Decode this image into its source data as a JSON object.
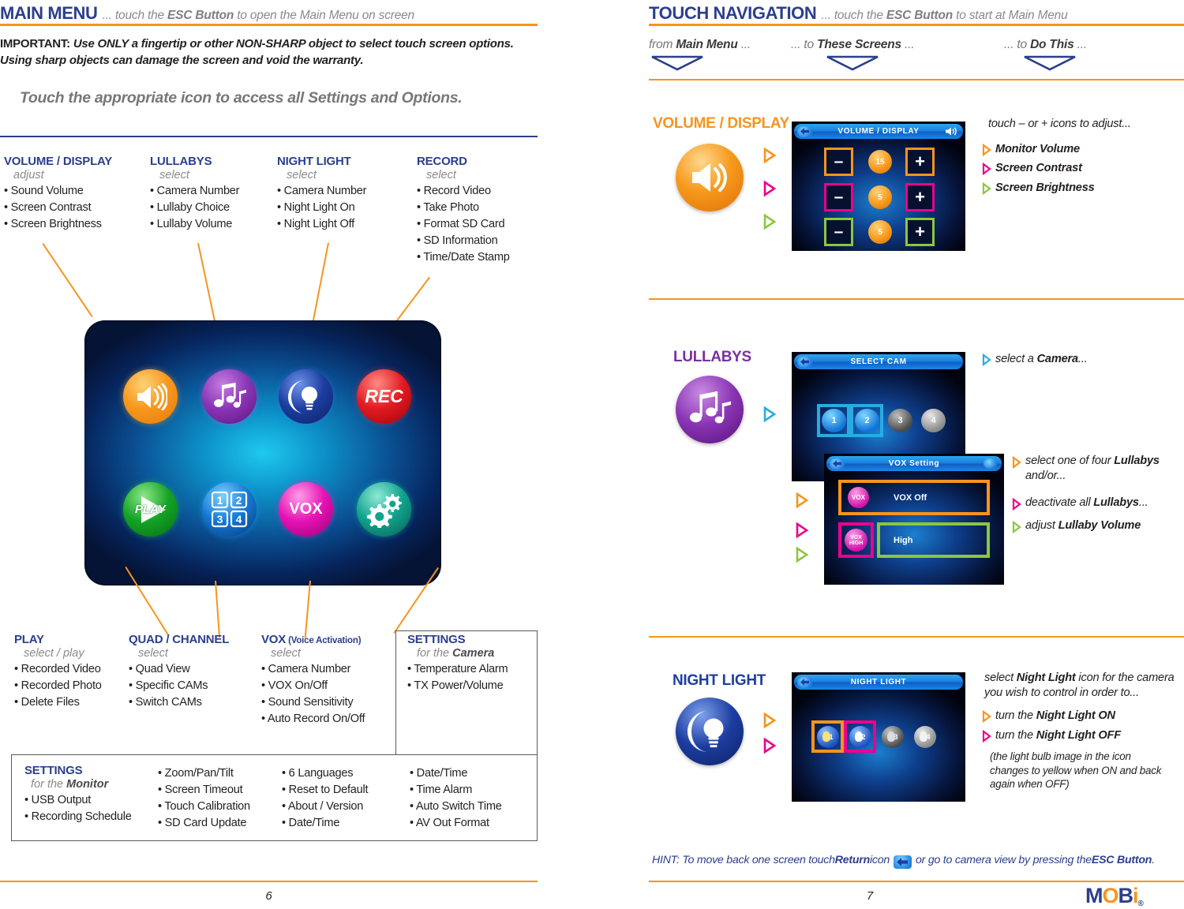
{
  "left_page": {
    "header": {
      "title": "MAIN MENU",
      "subtitle_pre": "... touch the ",
      "subtitle_bold": "ESC Button",
      "subtitle_post": " to open the Main Menu on screen"
    },
    "important": {
      "label": "IMPORTANT:",
      "text": "Use ONLY a fingertip or other NON-SHARP object to select touch screen options. Using sharp objects can damage the screen and void the warranty."
    },
    "instruction": "Touch the appropriate icon to access all Settings and Options.",
    "top_columns": [
      {
        "title": "VOLUME / DISPLAY",
        "verb": "adjust",
        "items": [
          "Sound Volume",
          "Screen Contrast",
          "Screen Brightness"
        ]
      },
      {
        "title": "LULLABYS",
        "verb": "select",
        "items": [
          "Camera Number",
          "Lullaby Choice",
          "Lullaby Volume"
        ]
      },
      {
        "title": "NIGHT LIGHT",
        "verb": "select",
        "items": [
          "Camera Number",
          "Night Light On",
          "Night Light Off"
        ]
      },
      {
        "title": "RECORD",
        "verb": "select",
        "items": [
          "Record Video",
          "Take Photo",
          "Format SD Card",
          "SD Information",
          "Time/Date Stamp"
        ]
      }
    ],
    "menu_icons": [
      {
        "name": "volume-icon",
        "label": "",
        "color": "#f7941e"
      },
      {
        "name": "lullaby-music-icon",
        "label": "",
        "color": "#7b2fa0"
      },
      {
        "name": "night-light-icon",
        "label": "",
        "color": "#1e3f9e"
      },
      {
        "name": "record-icon",
        "label": "REC",
        "color": "#e01b24"
      },
      {
        "name": "play-icon",
        "label": "PLAY",
        "color": "#1aa226"
      },
      {
        "name": "quad-channel-icon",
        "label": "",
        "color": "#1478d4"
      },
      {
        "name": "vox-icon",
        "label": "VOX",
        "color": "#e612b4"
      },
      {
        "name": "settings-gear-icon",
        "label": "",
        "color": "#11a38c"
      }
    ],
    "bottom_columns": [
      {
        "title": "PLAY",
        "verb": "select / play",
        "items": [
          "Recorded Video",
          "Recorded Photo",
          "Delete Files"
        ]
      },
      {
        "title": "QUAD / CHANNEL",
        "verb": "select",
        "items": [
          "Quad View",
          "Specific CAMs",
          "Switch CAMs"
        ]
      },
      {
        "title": "VOX",
        "title_small": " (Voice Activation)",
        "verb": "select",
        "items": [
          "Camera Number",
          "VOX On/Off",
          "Sound Sensitivity",
          "Auto Record On/Off"
        ]
      },
      {
        "title": "SETTINGS",
        "verb_pre": "for the ",
        "verb_bold": "Camera",
        "items": [
          "Temperature Alarm",
          "TX Power/Volume"
        ]
      }
    ],
    "monitor_box": {
      "title": "SETTINGS",
      "verb_pre": "for the ",
      "verb_bold": "Monitor",
      "col1": [
        "USB Output",
        "Recording Schedule"
      ],
      "col2": [
        "Zoom/Pan/Tilt",
        "Screen Timeout",
        "Touch Calibration",
        "SD Card Update"
      ],
      "col3": [
        "6 Languages",
        "Reset to Default",
        "About / Version",
        "Date/Time"
      ],
      "col4": [
        "Date/Time",
        "Time Alarm",
        "Auto Switch Time",
        "AV Out Format"
      ]
    },
    "page_number": "6"
  },
  "right_page": {
    "header": {
      "title": "TOUCH NAVIGATION",
      "subtitle_pre": "... touch the ",
      "subtitle_bold": "ESC Button",
      "subtitle_post": " to start at Main Menu"
    },
    "nav_columns": [
      {
        "pre": "from ",
        "bold": "Main Menu",
        "post": " ..."
      },
      {
        "pre": "... to ",
        "bold": "These Screens",
        "post": " ..."
      },
      {
        "pre": "... to ",
        "bold": "Do This",
        "post": " ..."
      }
    ],
    "groups": [
      {
        "name": "volume-display",
        "title": "VOLUME / DISPLAY",
        "title_color": "#f7941e",
        "icon": "volume-icon",
        "markers": [
          "#f7941e",
          "#ec008c",
          "#8dc63f"
        ],
        "screen": {
          "title": "VOLUME / DISPLAY",
          "rows": [
            {
              "minus": "–",
              "plus": "+",
              "value": "15",
              "icon": "speaker-icon",
              "color": "#f7941e"
            },
            {
              "minus": "–",
              "plus": "+",
              "value": "5",
              "icon": "contrast-icon",
              "color": "#ec008c"
            },
            {
              "minus": "–",
              "plus": "+",
              "value": "5",
              "icon": "brightness-icon",
              "color": "#8dc63f"
            }
          ]
        },
        "intro": "touch  –  or  +  icons to adjust...",
        "notes": [
          {
            "color": "#f7941e",
            "pre": "",
            "bold": "Monitor Volume",
            "post": ""
          },
          {
            "color": "#ec008c",
            "pre": "",
            "bold": "Screen Contrast",
            "post": ""
          },
          {
            "color": "#8dc63f",
            "pre": "",
            "bold": "Screen Brightness",
            "post": ""
          }
        ]
      },
      {
        "name": "lullabys",
        "title": "LULLABYS",
        "title_color": "#7b2fa0",
        "icon": "lullaby-music-icon",
        "markers": [
          "#29abe2"
        ],
        "screen": {
          "title": "SELECT CAM",
          "cams": [
            "1",
            "2",
            "3",
            "4"
          ]
        },
        "note_top": {
          "color": "#29abe2",
          "pre": "select a ",
          "bold": "Camera",
          "post": "..."
        },
        "screen2": {
          "title": "VOX Setting",
          "rows": [
            {
              "label": "VOX Off",
              "badge": "VOX"
            },
            {
              "label": "High",
              "badge": "VOX HIGH"
            }
          ]
        },
        "markers2": [
          "#f7941e",
          "#ec008c",
          "#8dc63f"
        ],
        "notes2": [
          {
            "color": "#f7941e",
            "pre": "select one of four ",
            "bold": "Lullabys",
            "post": " and/or..."
          },
          {
            "color": "#ec008c",
            "pre": "deactivate all ",
            "bold": "Lullabys",
            "post": "..."
          },
          {
            "color": "#8dc63f",
            "pre": "adjust ",
            "bold": "Lullaby Volume",
            "post": ""
          }
        ]
      },
      {
        "name": "night-light",
        "title": "NIGHT LIGHT",
        "title_color": "#1e3f9e",
        "icon": "night-light-icon",
        "markers": [
          "#f7941e",
          "#ec008c"
        ],
        "screen": {
          "title": "NIGHT LIGHT",
          "cams": [
            "1",
            "2",
            "3",
            "4"
          ]
        },
        "intro": "select Night Light icon for the camera you wish to control in order to...",
        "intro_bold": "Night Light",
        "notes": [
          {
            "color": "#f7941e",
            "pre": "turn the ",
            "bold": "Night Light ON",
            "post": ""
          },
          {
            "color": "#ec008c",
            "pre": "turn the ",
            "bold": "Night Light OFF",
            "post": ""
          }
        ],
        "footnote": "(the light bulb image in the icon changes to yellow when ON and back again when OFF)"
      }
    ],
    "hint": {
      "pre": "HINT: To move back one screen touch ",
      "bold1": "Return",
      "mid": " icon ",
      "icon": "return-icon",
      "post": " or go to camera view by pressing the ",
      "bold2": "ESC Button",
      "end": "."
    },
    "page_number": "7",
    "logo": "MOBi"
  }
}
